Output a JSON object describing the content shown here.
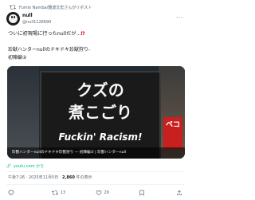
{
  "repost": {
    "text": "Fumio Namba/難波文宏さんがリポスト"
  },
  "author": {
    "name": "null",
    "handle": "@null1126690"
  },
  "more_label": "···",
  "post": {
    "line1": "ついに初現場に行ったnullだが...",
    "emphasis": "⁉",
    "line2": "珍獣ハンターnullのドキドキ珍獣狩り-\n初陣編②"
  },
  "media": {
    "sign_line1": "クズの",
    "sign_line2": "煮こごり",
    "sign_english": "Fuckin' Racism!",
    "side_sign": "ペコ",
    "caption": "珍獣ハンターnullのドキドキ珍獣狩り — 初陣編② | 珍獣ハンターnull"
  },
  "link": {
    "text": "youtu.com から"
  },
  "meta": {
    "time": "午後7:26 · 2025年11月5日 · ",
    "views_count": "2,860",
    "views_label": " 件の表示"
  },
  "actions": {
    "reply_count": "",
    "repost_count": "13",
    "like_count": "29",
    "bookmark_count": ""
  }
}
